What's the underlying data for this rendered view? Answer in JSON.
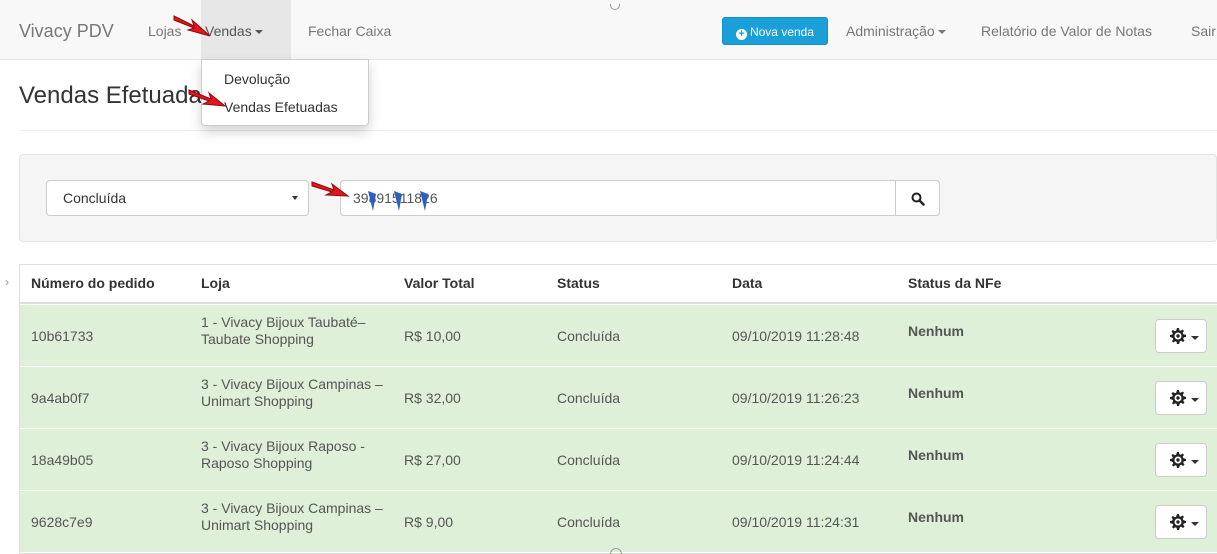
{
  "navbar": {
    "brand": "Vivacy PDV",
    "items": [
      {
        "label": "Lojas"
      },
      {
        "label": "Vendas"
      },
      {
        "label": "Fechar Caixa"
      }
    ],
    "nova_venda_label": "Nova venda",
    "right_items": [
      {
        "label": "Administração"
      },
      {
        "label": "Relatório de Valor de Notas"
      },
      {
        "label": "Sair"
      }
    ]
  },
  "dropdown": {
    "items": [
      {
        "label": "Devolução"
      },
      {
        "label": "Vendas Efetuadas"
      }
    ]
  },
  "page": {
    "title": "Vendas Efetuadas"
  },
  "filters": {
    "status_selected": "Concluída",
    "search_value": "39891511826"
  },
  "table": {
    "headers": [
      "Número do pedido",
      "Loja",
      "Valor Total",
      "Status",
      "Data",
      "Status da NFe"
    ],
    "rows": [
      {
        "pedido": "10b61733",
        "loja": "1 - Vivacy Bijoux Taubaté– Taubate Shopping",
        "valor": "R$ 10,00",
        "status": "Concluída",
        "data": "09/10/2019 11:28:48",
        "nfe": "Nenhum"
      },
      {
        "pedido": "9a4ab0f7",
        "loja": "3 - Vivacy Bijoux Campinas – Unimart Shopping",
        "valor": "R$ 32,00",
        "status": "Concluída",
        "data": "09/10/2019 11:26:23",
        "nfe": "Nenhum"
      },
      {
        "pedido": "18a49b05",
        "loja": "3 - Vivacy Bijoux Raposo - Raposo Shopping",
        "valor": "R$ 27,00",
        "status": "Concluída",
        "data": "09/10/2019 11:24:44",
        "nfe": "Nenhum"
      },
      {
        "pedido": "9628c7e9",
        "loja": "3 - Vivacy Bijoux Campinas – Unimart Shopping",
        "valor": "R$ 9,00",
        "status": "Concluída",
        "data": "09/10/2019 11:24:31",
        "nfe": "Nenhum"
      }
    ]
  },
  "colors": {
    "navbar_bg": "#f8f8f8",
    "accent": "#1a9fd8",
    "row_success": "#dff0d8",
    "annotation_red": "#e8141b",
    "annotation_blue": "#2b5fc0"
  }
}
